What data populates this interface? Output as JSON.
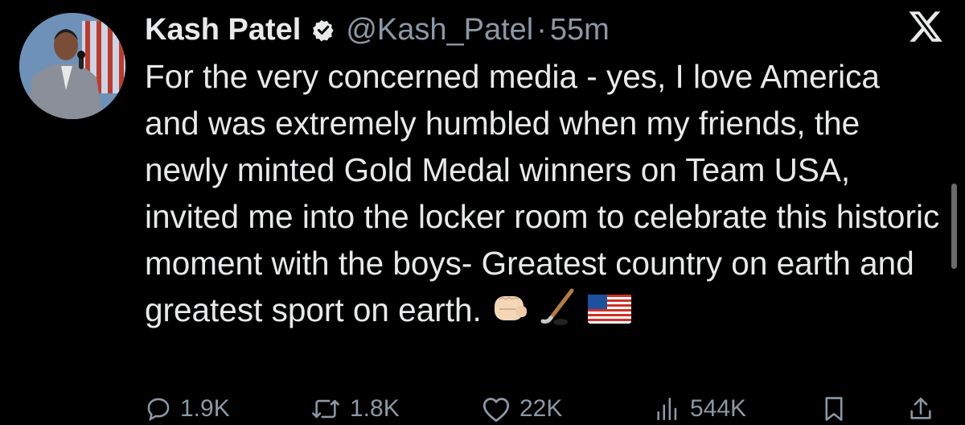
{
  "tweet": {
    "display_name": "Kash Patel",
    "handle": "@Kash_Patel",
    "separator": "·",
    "time": "55m",
    "text": "For the very concerned media - yes, I love America and was extremely humbled when my friends, the newly minted Gold Medal winners on Team USA, invited me into the locker room to celebrate this historic moment with the boys- Greatest country on earth and greatest sport on earth.",
    "emojis": [
      "fist-emoji",
      "hockey-stick-emoji",
      "us-flag-emoji"
    ],
    "verified_icon": "verified-badge-icon",
    "platform_icon": "x-logo-icon"
  },
  "actions": {
    "replies": "1.9K",
    "reposts": "1.8K",
    "likes": "22K",
    "views": "544K",
    "icons": [
      "reply-icon",
      "repost-icon",
      "like-icon",
      "views-icon",
      "bookmark-icon",
      "share-icon"
    ]
  },
  "colors": {
    "background": "#000000",
    "text": "#e7e9ea",
    "secondary": "#8b98a5"
  }
}
